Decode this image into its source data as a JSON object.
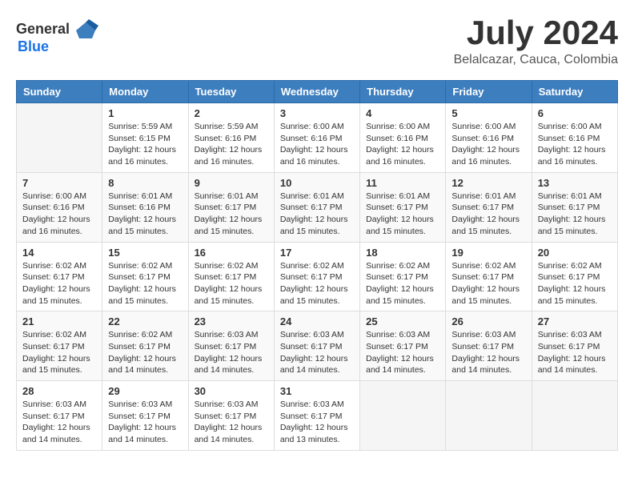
{
  "header": {
    "logo_general": "General",
    "logo_blue": "Blue",
    "title": "July 2024",
    "location": "Belalcazar, Cauca, Colombia"
  },
  "days_of_week": [
    "Sunday",
    "Monday",
    "Tuesday",
    "Wednesday",
    "Thursday",
    "Friday",
    "Saturday"
  ],
  "weeks": [
    [
      {
        "day": "",
        "info": ""
      },
      {
        "day": "1",
        "info": "Sunrise: 5:59 AM\nSunset: 6:15 PM\nDaylight: 12 hours\nand 16 minutes."
      },
      {
        "day": "2",
        "info": "Sunrise: 5:59 AM\nSunset: 6:16 PM\nDaylight: 12 hours\nand 16 minutes."
      },
      {
        "day": "3",
        "info": "Sunrise: 6:00 AM\nSunset: 6:16 PM\nDaylight: 12 hours\nand 16 minutes."
      },
      {
        "day": "4",
        "info": "Sunrise: 6:00 AM\nSunset: 6:16 PM\nDaylight: 12 hours\nand 16 minutes."
      },
      {
        "day": "5",
        "info": "Sunrise: 6:00 AM\nSunset: 6:16 PM\nDaylight: 12 hours\nand 16 minutes."
      },
      {
        "day": "6",
        "info": "Sunrise: 6:00 AM\nSunset: 6:16 PM\nDaylight: 12 hours\nand 16 minutes."
      }
    ],
    [
      {
        "day": "7",
        "info": "Sunrise: 6:00 AM\nSunset: 6:16 PM\nDaylight: 12 hours\nand 16 minutes."
      },
      {
        "day": "8",
        "info": "Sunrise: 6:01 AM\nSunset: 6:16 PM\nDaylight: 12 hours\nand 15 minutes."
      },
      {
        "day": "9",
        "info": "Sunrise: 6:01 AM\nSunset: 6:17 PM\nDaylight: 12 hours\nand 15 minutes."
      },
      {
        "day": "10",
        "info": "Sunrise: 6:01 AM\nSunset: 6:17 PM\nDaylight: 12 hours\nand 15 minutes."
      },
      {
        "day": "11",
        "info": "Sunrise: 6:01 AM\nSunset: 6:17 PM\nDaylight: 12 hours\nand 15 minutes."
      },
      {
        "day": "12",
        "info": "Sunrise: 6:01 AM\nSunset: 6:17 PM\nDaylight: 12 hours\nand 15 minutes."
      },
      {
        "day": "13",
        "info": "Sunrise: 6:01 AM\nSunset: 6:17 PM\nDaylight: 12 hours\nand 15 minutes."
      }
    ],
    [
      {
        "day": "14",
        "info": "Sunrise: 6:02 AM\nSunset: 6:17 PM\nDaylight: 12 hours\nand 15 minutes."
      },
      {
        "day": "15",
        "info": "Sunrise: 6:02 AM\nSunset: 6:17 PM\nDaylight: 12 hours\nand 15 minutes."
      },
      {
        "day": "16",
        "info": "Sunrise: 6:02 AM\nSunset: 6:17 PM\nDaylight: 12 hours\nand 15 minutes."
      },
      {
        "day": "17",
        "info": "Sunrise: 6:02 AM\nSunset: 6:17 PM\nDaylight: 12 hours\nand 15 minutes."
      },
      {
        "day": "18",
        "info": "Sunrise: 6:02 AM\nSunset: 6:17 PM\nDaylight: 12 hours\nand 15 minutes."
      },
      {
        "day": "19",
        "info": "Sunrise: 6:02 AM\nSunset: 6:17 PM\nDaylight: 12 hours\nand 15 minutes."
      },
      {
        "day": "20",
        "info": "Sunrise: 6:02 AM\nSunset: 6:17 PM\nDaylight: 12 hours\nand 15 minutes."
      }
    ],
    [
      {
        "day": "21",
        "info": "Sunrise: 6:02 AM\nSunset: 6:17 PM\nDaylight: 12 hours\nand 15 minutes."
      },
      {
        "day": "22",
        "info": "Sunrise: 6:02 AM\nSunset: 6:17 PM\nDaylight: 12 hours\nand 14 minutes."
      },
      {
        "day": "23",
        "info": "Sunrise: 6:03 AM\nSunset: 6:17 PM\nDaylight: 12 hours\nand 14 minutes."
      },
      {
        "day": "24",
        "info": "Sunrise: 6:03 AM\nSunset: 6:17 PM\nDaylight: 12 hours\nand 14 minutes."
      },
      {
        "day": "25",
        "info": "Sunrise: 6:03 AM\nSunset: 6:17 PM\nDaylight: 12 hours\nand 14 minutes."
      },
      {
        "day": "26",
        "info": "Sunrise: 6:03 AM\nSunset: 6:17 PM\nDaylight: 12 hours\nand 14 minutes."
      },
      {
        "day": "27",
        "info": "Sunrise: 6:03 AM\nSunset: 6:17 PM\nDaylight: 12 hours\nand 14 minutes."
      }
    ],
    [
      {
        "day": "28",
        "info": "Sunrise: 6:03 AM\nSunset: 6:17 PM\nDaylight: 12 hours\nand 14 minutes."
      },
      {
        "day": "29",
        "info": "Sunrise: 6:03 AM\nSunset: 6:17 PM\nDaylight: 12 hours\nand 14 minutes."
      },
      {
        "day": "30",
        "info": "Sunrise: 6:03 AM\nSunset: 6:17 PM\nDaylight: 12 hours\nand 14 minutes."
      },
      {
        "day": "31",
        "info": "Sunrise: 6:03 AM\nSunset: 6:17 PM\nDaylight: 12 hours\nand 13 minutes."
      },
      {
        "day": "",
        "info": ""
      },
      {
        "day": "",
        "info": ""
      },
      {
        "day": "",
        "info": ""
      }
    ]
  ]
}
